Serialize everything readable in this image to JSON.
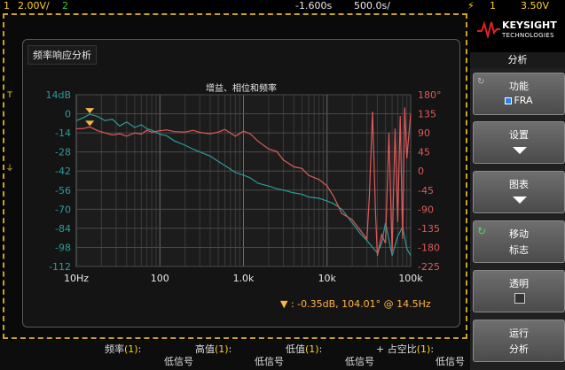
{
  "topbar": {
    "ch1_num": "1",
    "ch1_scale": "2.00V/",
    "ch2_num": "2",
    "time_delay": "-1.600s",
    "time_scale": "500.0s/",
    "trig_icon": "⚡",
    "trig_ch": "1",
    "trig_level": "3.50V"
  },
  "fra_window": {
    "title": "频率响应分析",
    "chart_title": "增益、相位和频率",
    "readout": "-0.35dB, 104.01° @ 14.5Hz"
  },
  "right_panel": {
    "brand_name": "KEYSIGHT",
    "brand_sub": "TECHNOLOGIES",
    "menu_header": "分析",
    "softkeys": [
      {
        "label": "功能",
        "value": "FRA"
      },
      {
        "label": "设置"
      },
      {
        "label": "图表"
      },
      {
        "label": "移动",
        "value": "标志"
      },
      {
        "label": "透明"
      },
      {
        "label": "运行",
        "value": "分析"
      }
    ]
  },
  "bottombar": {
    "measurements": [
      {
        "name": "频率",
        "ch": "(1)",
        "colon": ":",
        "value": "低信号"
      },
      {
        "name": "高值",
        "ch": "(1)",
        "colon": ":",
        "value": "低信号"
      },
      {
        "name": "低值",
        "ch": "(1)",
        "colon": ":",
        "value": "低信号"
      },
      {
        "name": "+ 占空比",
        "ch": "(1)",
        "colon": ":",
        "value": "低信号"
      }
    ]
  },
  "colors": {
    "gain": "#2a9d9a",
    "phase": "#e05a5a",
    "accent": "#ffd21f",
    "marker": "#ffb347"
  },
  "chart_data": {
    "type": "line",
    "x_scale": "log",
    "x_ticks": [
      "10Hz",
      "100",
      "1.0k",
      "10k",
      "100k"
    ],
    "x_tick_values": [
      10,
      100,
      1000,
      10000,
      100000
    ],
    "y_left_ticks": [
      "14dB",
      "0",
      "-14",
      "-28",
      "-42",
      "-56",
      "-70",
      "-84",
      "-98",
      "-112"
    ],
    "y_left_range": [
      -112,
      14
    ],
    "y_right_ticks": [
      "180°",
      "135",
      "90",
      "45",
      "0",
      "-45",
      "-90",
      "-135",
      "-180",
      "-225"
    ],
    "y_right_range": [
      -225,
      180
    ],
    "grid": true,
    "series": [
      {
        "axis": "left",
        "x": [
          10,
          12,
          14.5,
          18,
          22,
          27,
          33,
          40,
          50,
          60,
          70,
          80,
          100,
          120,
          150,
          200,
          250,
          300,
          400,
          500,
          600,
          800,
          1000,
          1200,
          1500,
          2000,
          2500,
          3000,
          4000,
          5000,
          6000,
          8000,
          10000,
          12000,
          15000,
          20000,
          25000,
          30000,
          35000,
          40000,
          45000,
          50000,
          60000,
          70000,
          80000,
          90000,
          100000
        ],
        "y": [
          -5,
          -3,
          -0.35,
          -2,
          -5,
          -4,
          -9,
          -6,
          -10,
          -8,
          -11,
          -12,
          -15,
          -16,
          -20,
          -23,
          -26,
          -28,
          -31,
          -35,
          -38,
          -43,
          -45,
          -47,
          -51,
          -53,
          -55,
          -56,
          -58,
          -59,
          -61,
          -62,
          -64,
          -66,
          -70,
          -80,
          -88,
          -93,
          -98,
          -102,
          -95,
          -80,
          -104,
          -90,
          -83,
          -99,
          -104
        ]
      },
      {
        "axis": "right",
        "x": [
          10,
          12,
          14.5,
          18,
          22,
          27,
          33,
          40,
          50,
          60,
          70,
          80,
          100,
          120,
          150,
          200,
          250,
          300,
          400,
          500,
          600,
          800,
          1000,
          1200,
          1500,
          2000,
          2500,
          3000,
          4000,
          5000,
          6000,
          8000,
          10000,
          12000,
          15000,
          20000,
          25000,
          30000,
          32000,
          35000,
          38000,
          40000,
          45000,
          50000,
          55000,
          60000,
          65000,
          70000,
          75000,
          80000,
          85000,
          90000,
          100000
        ],
        "y": [
          100,
          100,
          104,
          95,
          90,
          85,
          88,
          82,
          90,
          87,
          96,
          92,
          95,
          97,
          93,
          92,
          96,
          91,
          88,
          92,
          98,
          82,
          94,
          88,
          70,
          52,
          46,
          26,
          10,
          6,
          -10,
          -20,
          -35,
          -60,
          -100,
          -115,
          -140,
          -160,
          -60,
          140,
          -100,
          -200,
          -150,
          -170,
          90,
          -190,
          100,
          -120,
          130,
          -160,
          150,
          30,
          135
        ]
      }
    ]
  }
}
